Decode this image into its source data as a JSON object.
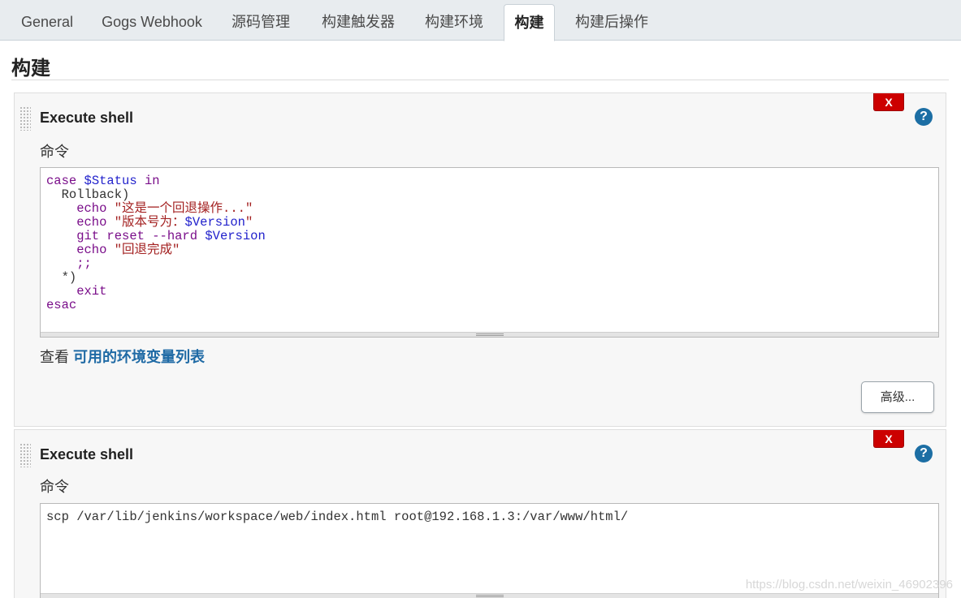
{
  "tabs": [
    {
      "label": "General"
    },
    {
      "label": "Gogs Webhook"
    },
    {
      "label": "源码管理"
    },
    {
      "label": "构建触发器"
    },
    {
      "label": "构建环境"
    },
    {
      "label": "构建",
      "active": true
    },
    {
      "label": "构建后操作"
    }
  ],
  "section": {
    "title": "构建"
  },
  "steps": [
    {
      "title": "Execute shell",
      "delete_label": "X",
      "help_label": "?",
      "field_label": "命令",
      "command_lines": [
        "case $Status in",
        "  Rollback)",
        "    echo \"这是一个回退操作...\"",
        "    echo \"版本号为：$Version\"",
        "    git reset --hard $Version",
        "    echo \"回退完成\"",
        "    ;;",
        "  *)",
        "    exit",
        "esac"
      ],
      "env_prefix": "查看 ",
      "env_link": "可用的环境变量列表",
      "advanced_label": "高级..."
    },
    {
      "title": "Execute shell",
      "delete_label": "X",
      "help_label": "?",
      "field_label": "命令",
      "command_lines": [
        "scp /var/lib/jenkins/workspace/web/index.html root@192.168.1.3:/var/www/html/"
      ]
    }
  ],
  "watermark": "https://blog.csdn.net/weixin_46902396",
  "colors": {
    "delete": "#cc0000",
    "help": "#1c6ea4",
    "link": "#1f6aa5",
    "keyword": "#7a0e8a",
    "variable": "#2222cc",
    "string": "#a32020"
  }
}
